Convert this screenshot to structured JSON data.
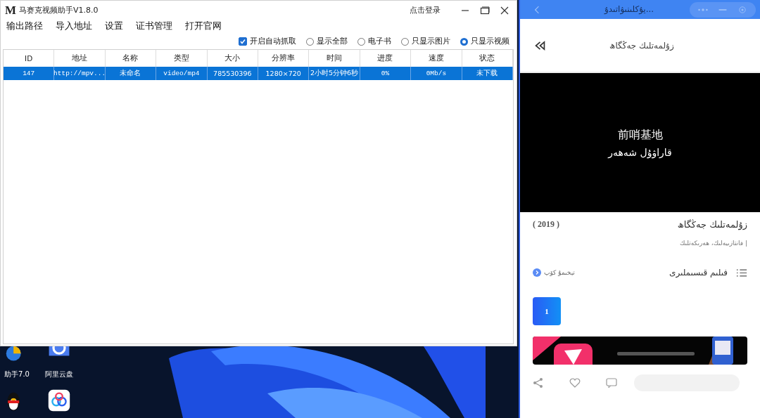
{
  "app_window": {
    "logo": "M",
    "title": "马赛克视频助手V1.8.0",
    "login": "点击登录",
    "menu": [
      "输出路径",
      "导入地址",
      "设置",
      "证书管理",
      "打开官网"
    ],
    "options": [
      {
        "kind": "checkbox",
        "label": "开启自动抓取",
        "checked": true
      },
      {
        "kind": "radio",
        "label": "显示全部",
        "selected": false
      },
      {
        "kind": "radio",
        "label": "电子书",
        "selected": false
      },
      {
        "kind": "radio",
        "label": "只显示图片",
        "selected": false
      },
      {
        "kind": "radio",
        "label": "只显示视频",
        "selected": true
      }
    ],
    "table": {
      "columns": [
        "ID",
        "地址",
        "名称",
        "类型",
        "大小",
        "分辨率",
        "时间",
        "进度",
        "速度",
        "状态"
      ],
      "rows": [
        {
          "selected": true,
          "cells": [
            "147",
            "http://mpv...",
            "未命名",
            "video/mp4",
            "785530396",
            "1280×720",
            "2小时5分钟6秒",
            "0%",
            "0Mb/s",
            "未下载"
          ]
        }
      ]
    }
  },
  "phone_window": {
    "title": "يۇكلىنىۋاتىدۇ...",
    "header": "زۇلمەتلىك جەڭگاھ",
    "video": {
      "caption": "前哨基地",
      "subtitle": "قاراۋۇل شەھەر"
    },
    "film_title": "زۇلمەتلىك جەڭگاھ",
    "year": "( 2019 )",
    "genres": "| فانتازىيەلىك، ھەرىكەتلىك",
    "episodes_label": "فىلىم قىسىملىرى",
    "more": "تېخىمۇ كۆپ",
    "episodes": [
      {
        "label": "1",
        "selected": true
      }
    ]
  },
  "desktop": {
    "icons": [
      {
        "label": "助手7.0",
        "kind": "app"
      },
      {
        "label": "阿里云盘",
        "kind": "cloud"
      },
      {
        "kind": "penguin"
      },
      {
        "kind": "baidu"
      }
    ]
  }
}
